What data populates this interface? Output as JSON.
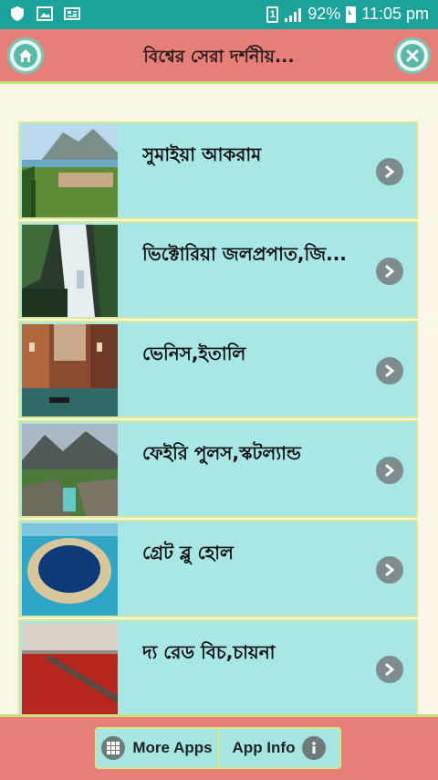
{
  "status_bar": {
    "sim_slot": "1",
    "battery": "92%",
    "time": "11:05 pm"
  },
  "header": {
    "title": "বিশ্বের সেরা দর্শনীয়..."
  },
  "list": {
    "items": [
      {
        "label": "সুমাইয়া আকরাম"
      },
      {
        "label": "ভিক্টোরিয়া জলপ্রপাত,জি..."
      },
      {
        "label": "ভেনিস,ইতালি"
      },
      {
        "label": "ফেইরি পুলস,স্কটল্যান্ড"
      },
      {
        "label": "গ্রেট ব্লু হোল"
      },
      {
        "label": "দ্য রেড বিচ,চায়না"
      }
    ]
  },
  "bottom_bar": {
    "more_apps": "More Apps",
    "app_info": "App Info"
  },
  "colors": {
    "status_bar": "#1aa39b",
    "header": "#e57f78",
    "row": "#a7e7e6",
    "accent_border": "#dbe997"
  }
}
